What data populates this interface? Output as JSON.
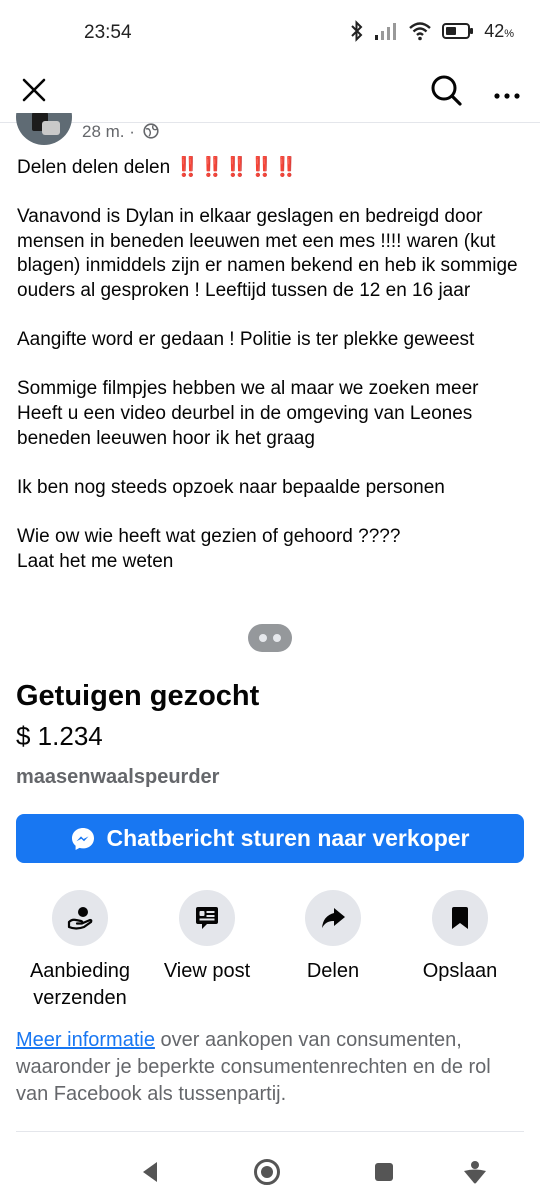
{
  "status_bar": {
    "time": "23:54",
    "battery_percent": "42",
    "battery_percent_symbol": "%",
    "icons": [
      "bluetooth-icon",
      "signal-icon",
      "wifi-icon",
      "battery-icon"
    ]
  },
  "topbar": {
    "icons": [
      "close-icon",
      "search-icon",
      "more-icon"
    ]
  },
  "post": {
    "time": "28 m.",
    "separator": "·",
    "first_line": "Delen delen delen",
    "emphasis": "‼️‼️‼️‼️‼️",
    "paragraphs": [
      "Vanavond is Dylan in elkaar geslagen en bedreigd door mensen  in beneden leeuwen met een mes !!!! waren (kut blagen) inmiddels zijn er namen bekend en heb ik sommige ouders al gesproken ! Leeftijd tussen de 12 en 16 jaar",
      "Aangifte word er gedaan ! Politie is ter plekke geweest",
      "Sommige filmpjes hebben we al maar we zoeken meer\nHeeft u een video deurbel in de omgeving van Leones beneden leeuwen hoor ik het graag",
      "Ik ben nog steeds opzoek naar bepaalde personen",
      "Wie ow wie heeft wat gezien of gehoord ????\nLaat het me weten"
    ]
  },
  "listing": {
    "title": "Getuigen gezocht",
    "price": "$ 1.234",
    "seller": "maasenwaalspeurder",
    "chat_button_label": "Chatbericht sturen naar verkoper"
  },
  "actions": [
    {
      "label": "Aanbieding verzenden",
      "icon": "hand-offer-icon"
    },
    {
      "label": "View post",
      "icon": "post-icon"
    },
    {
      "label": "Delen",
      "icon": "share-icon"
    },
    {
      "label": "Opslaan",
      "icon": "bookmark-icon"
    }
  ],
  "info": {
    "link_text": "Meer informatie",
    "rest_text": " over aankopen van consumenten, waaronder je beperkte consumentenrechten en de rol van Facebook als tussenpartij."
  },
  "colors": {
    "accent": "#1877f2",
    "secondary_text": "#65676b",
    "emphasis": "#e0245e"
  }
}
